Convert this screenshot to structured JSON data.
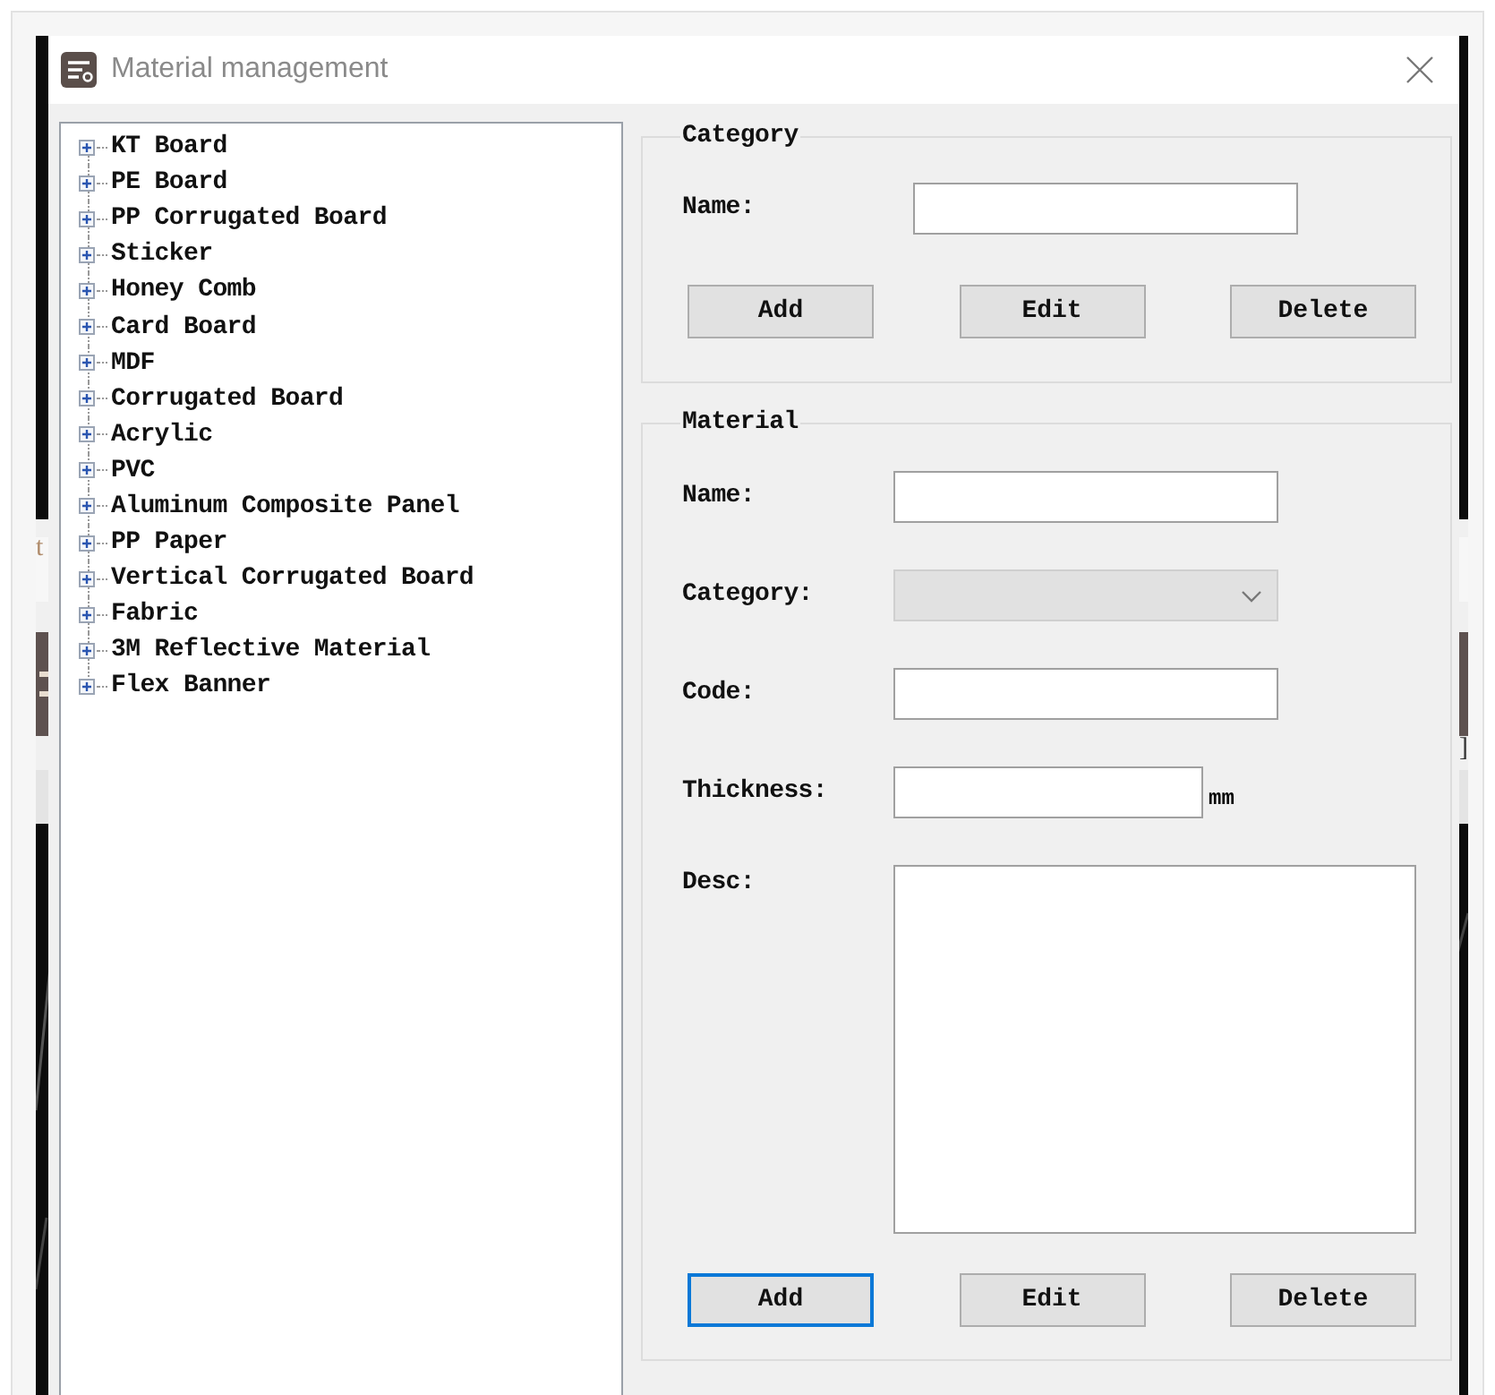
{
  "background": {
    "kind": "picture",
    "text_fragments": [
      "t",
      "]"
    ]
  },
  "window": {
    "title": "Material management"
  },
  "tree": {
    "items": [
      {
        "label": "KT Board",
        "expanded": false
      },
      {
        "label": "PE Board",
        "expanded": false
      },
      {
        "label": "PP Corrugated Board",
        "expanded": false
      },
      {
        "label": "Sticker",
        "expanded": false
      },
      {
        "label": "Honey Comb",
        "expanded": false
      },
      {
        "label": "Card Board",
        "expanded": false
      },
      {
        "label": "MDF",
        "expanded": false
      },
      {
        "label": "Corrugated Board",
        "expanded": false
      },
      {
        "label": "Acrylic",
        "expanded": false
      },
      {
        "label": "PVC",
        "expanded": false
      },
      {
        "label": "Aluminum Composite Panel",
        "expanded": false
      },
      {
        "label": "PP Paper",
        "expanded": false
      },
      {
        "label": "Vertical Corrugated Board",
        "expanded": false
      },
      {
        "label": "Fabric",
        "expanded": false
      },
      {
        "label": "3M Reflective Material",
        "expanded": false
      },
      {
        "label": "Flex Banner",
        "expanded": false
      }
    ]
  },
  "category_group": {
    "title": "Category",
    "fields": [
      {
        "label": "Name:",
        "kind": "text",
        "disabled": false
      }
    ],
    "buttons": [
      {
        "label": "Add",
        "focused": false
      },
      {
        "label": "Edit",
        "focused": false
      },
      {
        "label": "Delete",
        "focused": false
      }
    ]
  },
  "material_group": {
    "title": "Material",
    "fields": [
      {
        "label": "Name:",
        "kind": "text",
        "disabled": false
      },
      {
        "label": "Category:",
        "kind": "combo",
        "disabled": true
      },
      {
        "label": "Code:",
        "kind": "text",
        "disabled": false
      },
      {
        "label": "Thickness:",
        "kind": "unit",
        "unit": "mm",
        "disabled": false
      },
      {
        "label": "Desc:",
        "kind": "textarea",
        "disabled": false
      }
    ],
    "buttons": [
      {
        "label": "Add",
        "focused": true
      },
      {
        "label": "Edit",
        "focused": false
      },
      {
        "label": "Delete",
        "focused": false
      }
    ]
  }
}
